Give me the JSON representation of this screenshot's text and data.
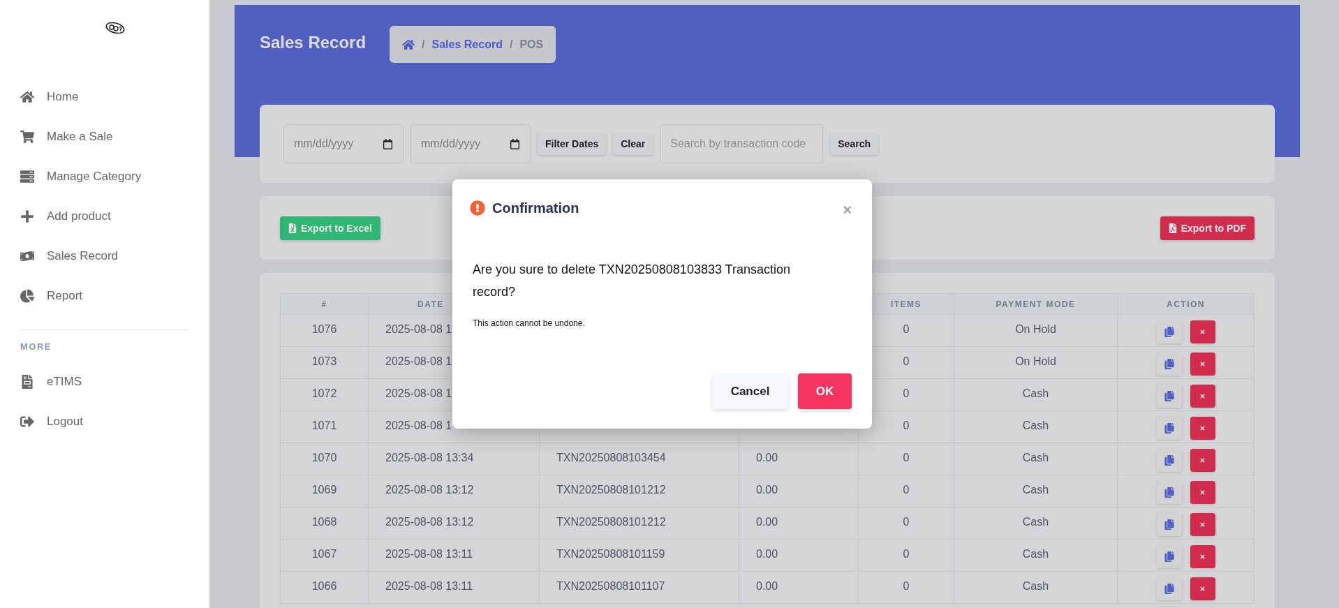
{
  "sidebar": {
    "items": [
      {
        "label": "Home"
      },
      {
        "label": "Make a Sale"
      },
      {
        "label": "Manage Category"
      },
      {
        "label": "Add product"
      },
      {
        "label": "Sales Record"
      },
      {
        "label": "Report"
      }
    ],
    "section_title": "MORE",
    "more_items": [
      {
        "label": "eTIMS"
      },
      {
        "label": "Logout"
      }
    ]
  },
  "header": {
    "title": "Sales Record",
    "breadcrumb": [
      {
        "separator": "/",
        "label": "Sales Record",
        "link": true
      },
      {
        "separator": "/",
        "label": "POS",
        "link": false
      }
    ]
  },
  "filters": {
    "date_from": {
      "placeholder": "mm/dd/yyyy"
    },
    "date_to": {
      "placeholder": "mm/dd/yyyy"
    },
    "filter_button": "Filter Dates",
    "clear_button": "Clear",
    "search": {
      "placeholder": "Search by transaction code"
    },
    "search_button": "Search"
  },
  "exports": {
    "excel": "Export to Excel",
    "pdf": "Export to PDF"
  },
  "table": {
    "header": {
      "number": "#",
      "date": "DATE",
      "items": "ITEMS",
      "payment_mode": "PAYMENT MODE",
      "action": "ACTION"
    },
    "rows": [
      {
        "number": "1076",
        "date": "2025-08-08 1",
        "items": "0",
        "payment_mode": "On Hold"
      },
      {
        "number": "1073",
        "date": "2025-08-08 1",
        "items": "0",
        "payment_mode": "On Hold"
      },
      {
        "number": "1072",
        "date": "2025-08-08 1",
        "items": "0",
        "payment_mode": "Cash"
      },
      {
        "number": "1071",
        "date": "2025-08-08 1",
        "items": "0",
        "payment_mode": "Cash"
      },
      {
        "number": "1070",
        "date": "2025-08-08 13:34",
        "code": "TXN20250808103454",
        "amount": "0.00",
        "items": "0",
        "payment_mode": "Cash"
      },
      {
        "number": "1069",
        "date": "2025-08-08 13:12",
        "code": "TXN20250808101212",
        "amount": "0.00",
        "items": "0",
        "payment_mode": "Cash"
      },
      {
        "number": "1068",
        "date": "2025-08-08 13:12",
        "code": "TXN20250808101212",
        "amount": "0.00",
        "items": "0",
        "payment_mode": "Cash"
      },
      {
        "number": "1067",
        "date": "2025-08-08 13:11",
        "code": "TXN20250808101159",
        "amount": "0.00",
        "items": "0",
        "payment_mode": "Cash"
      },
      {
        "number": "1066",
        "date": "2025-08-08 13:11",
        "code": "TXN20250808101107",
        "amount": "0.00",
        "items": "0",
        "payment_mode": "Cash"
      }
    ]
  },
  "dialog": {
    "title": "Confirmation",
    "close": "×",
    "message": "Are you sure to delete TXN20250808103833 Transaction record?",
    "note": "This action cannot be undone.",
    "cancel": "Cancel",
    "ok": "OK"
  }
}
